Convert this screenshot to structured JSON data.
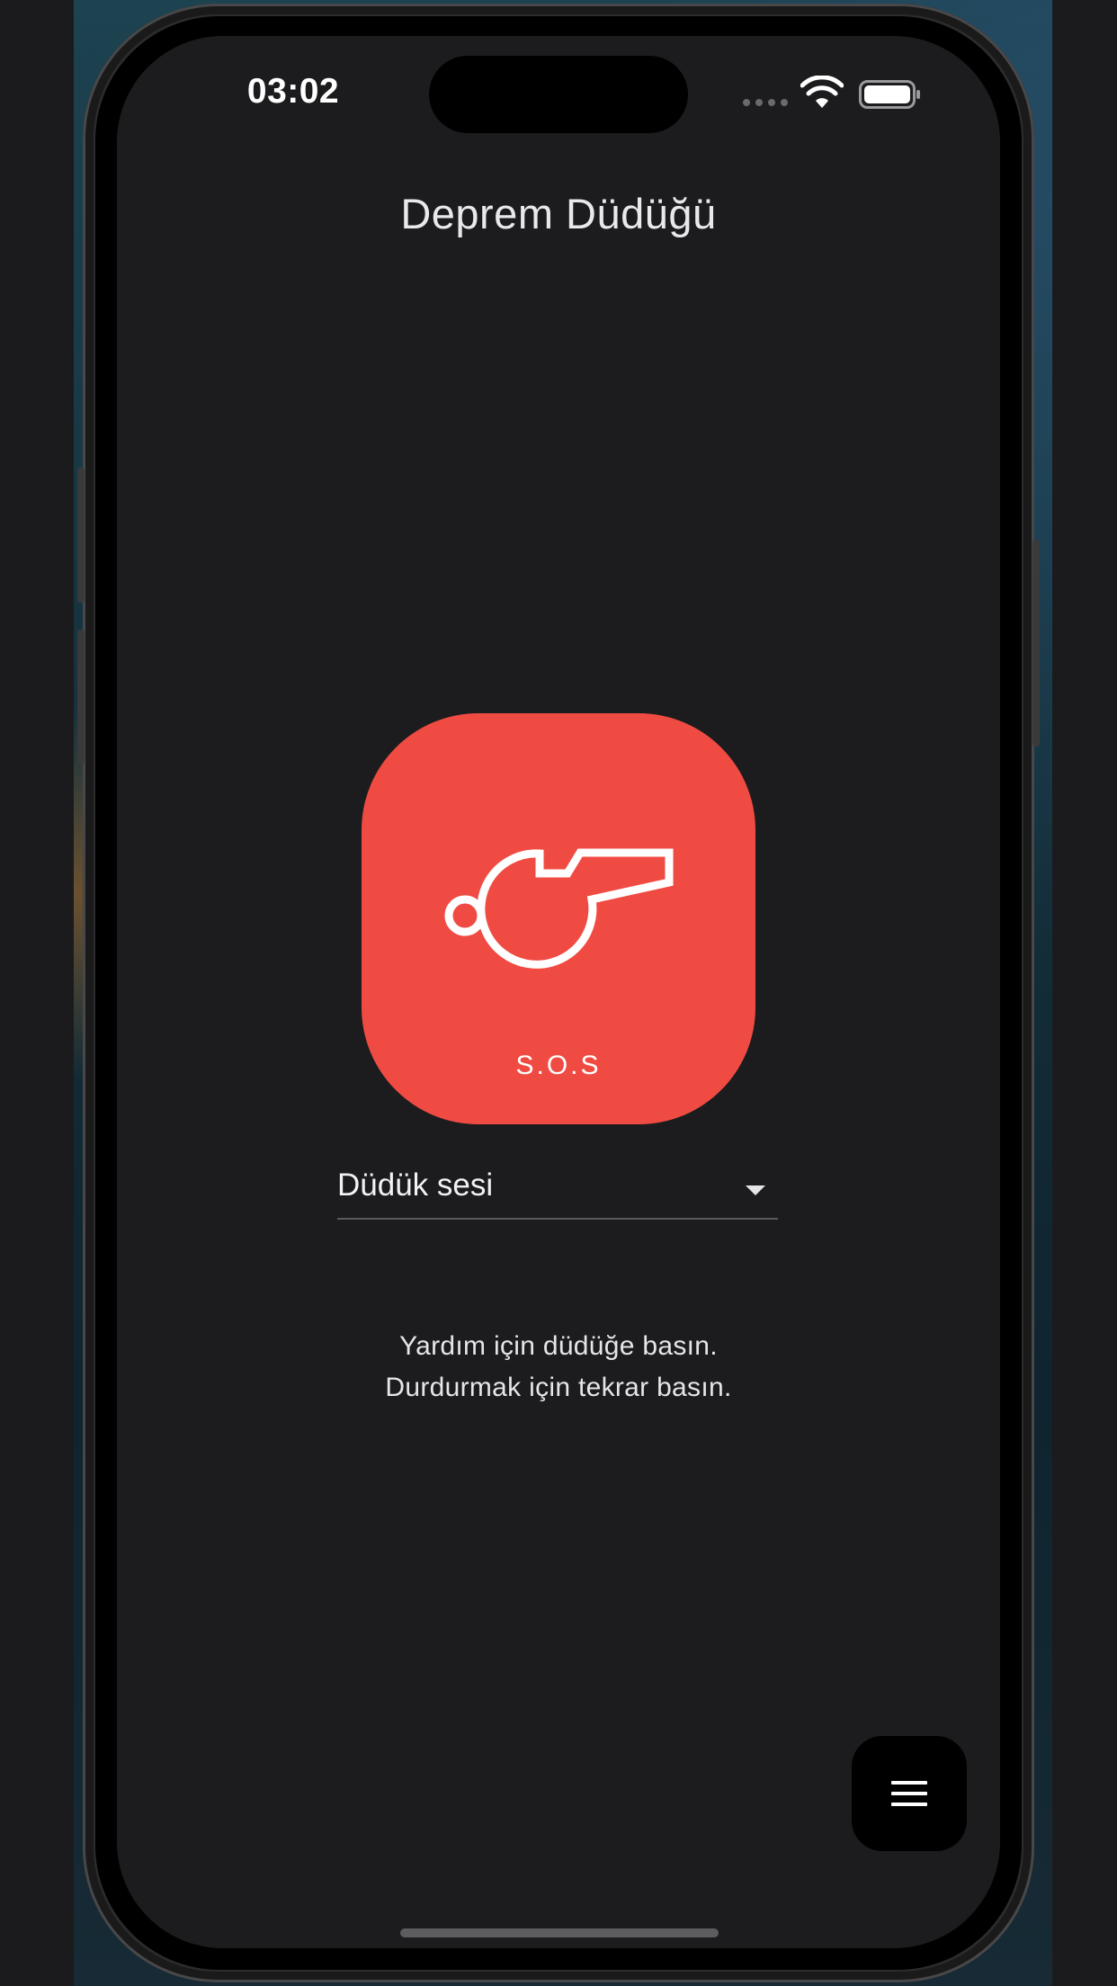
{
  "status_bar": {
    "time": "03:02",
    "signal_icon": "cellular-signal-icon",
    "wifi_icon": "wifi-icon",
    "battery_icon": "battery-icon"
  },
  "header": {
    "title": "Deprem Düdüğü"
  },
  "sos_button": {
    "icon": "whistle-icon",
    "label": "S.O.S",
    "color": "#f04b43"
  },
  "sound_select": {
    "selected": "Düdük sesi",
    "icon": "chevron-down-icon"
  },
  "instructions": {
    "line1": "Yardım için düdüğe basın.",
    "line2": "Durdurmak için tekrar basın."
  },
  "menu_button": {
    "icon": "menu-icon"
  },
  "colors": {
    "background": "#1c1c1e",
    "accent": "#f04b43",
    "text": "#e9e9eb"
  }
}
